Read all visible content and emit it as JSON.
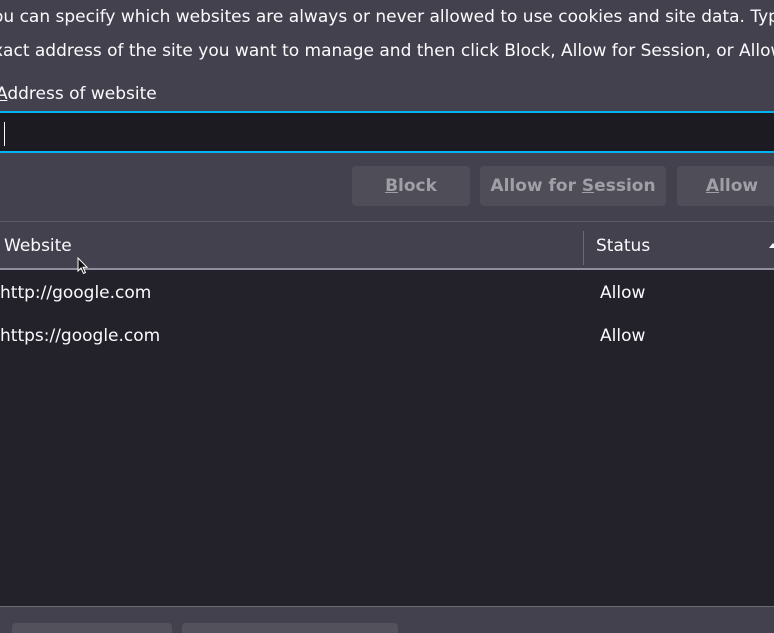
{
  "description": {
    "line1": "ou can specify which websites are always or never allowed to use cookies and site data. Type th",
    "line2": "xact address of the site you want to manage and then click Block, Allow for Session, or Allow."
  },
  "address": {
    "label_accesskey": "A",
    "label_rest": "ddress of website",
    "value": ""
  },
  "buttons": {
    "block": {
      "accesskey": "B",
      "rest": "lock"
    },
    "allow_session": {
      "before": "Allow for ",
      "accesskey": "S",
      "rest": "ession"
    },
    "allow": {
      "accesskey": "A",
      "rest": "llow"
    }
  },
  "table": {
    "headers": {
      "website": "Website",
      "status": "Status"
    },
    "sort_icon": "sort-ascending-icon",
    "rows": [
      {
        "website": "http://google.com",
        "status": "Allow"
      },
      {
        "website": "https://google.com",
        "status": "Allow"
      }
    ]
  },
  "colors": {
    "background": "#42414d",
    "table_background": "#23222b",
    "input_border": "#00b3f4",
    "button_background": "#4e4d58",
    "disabled_text": "#a09fa6",
    "text": "#fbfbfe"
  }
}
